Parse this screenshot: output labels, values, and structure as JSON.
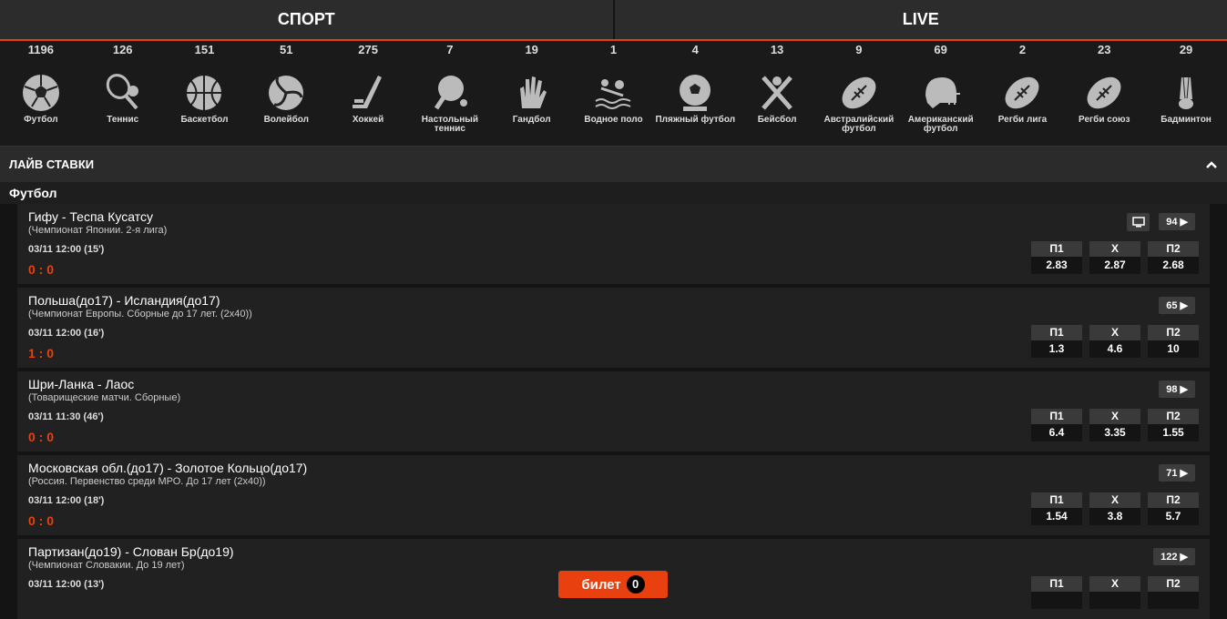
{
  "tabs": [
    "СПОРТ",
    "LIVE"
  ],
  "sports": [
    {
      "count": "1196",
      "label": "Футбол",
      "icon": "soccer-ball-icon"
    },
    {
      "count": "126",
      "label": "Теннис",
      "icon": "tennis-racket-icon"
    },
    {
      "count": "151",
      "label": "Баскетбол",
      "icon": "basketball-icon"
    },
    {
      "count": "51",
      "label": "Волейбол",
      "icon": "volleyball-icon"
    },
    {
      "count": "275",
      "label": "Хоккей",
      "icon": "hockey-stick-icon"
    },
    {
      "count": "7",
      "label": "Настольный теннис",
      "icon": "table-tennis-icon"
    },
    {
      "count": "19",
      "label": "Гандбол",
      "icon": "handball-glove-icon"
    },
    {
      "count": "1",
      "label": "Водное поло",
      "icon": "water-polo-icon"
    },
    {
      "count": "4",
      "label": "Пляжный футбол",
      "icon": "beach-soccer-icon"
    },
    {
      "count": "13",
      "label": "Бейсбол",
      "icon": "baseball-bats-icon"
    },
    {
      "count": "9",
      "label": "Австралийский футбол",
      "icon": "aussie-football-icon"
    },
    {
      "count": "69",
      "label": "Американский футбол",
      "icon": "football-helmet-icon"
    },
    {
      "count": "2",
      "label": "Регби лига",
      "icon": "rugby-ball-icon"
    },
    {
      "count": "23",
      "label": "Регби союз",
      "icon": "rugby-union-ball-icon"
    },
    {
      "count": "29",
      "label": "Бадминтон",
      "icon": "shuttlecock-icon"
    }
  ],
  "section": {
    "title": "ЛАЙВ СТАВКИ"
  },
  "category": "Футбол",
  "matches": [
    {
      "title": "Гифу - Теспа Кусатсу",
      "league": "(Чемпионат Японии. 2-я лига)",
      "time": "03/11 12:00 (15')",
      "score": "0 : 0",
      "more": "94 ▶",
      "tv": true,
      "odds": [
        {
          "h": "П1",
          "v": "2.83"
        },
        {
          "h": "Х",
          "v": "2.87"
        },
        {
          "h": "П2",
          "v": "2.68"
        }
      ]
    },
    {
      "title": "Польша(до17) - Исландия(до17)",
      "league": "(Чемпионат Европы. Сборные до 17 лет. (2х40))",
      "time": "03/11 12:00 (16')",
      "score": "1 : 0",
      "more": "65 ▶",
      "tv": false,
      "odds": [
        {
          "h": "П1",
          "v": "1.3"
        },
        {
          "h": "Х",
          "v": "4.6"
        },
        {
          "h": "П2",
          "v": "10"
        }
      ]
    },
    {
      "title": "Шри-Ланка - Лаос",
      "league": "(Товарищеские матчи. Сборные)",
      "time": "03/11 11:30 (46')",
      "score": "0 : 0",
      "more": "98 ▶",
      "tv": false,
      "odds": [
        {
          "h": "П1",
          "v": "6.4"
        },
        {
          "h": "Х",
          "v": "3.35"
        },
        {
          "h": "П2",
          "v": "1.55"
        }
      ]
    },
    {
      "title": "Московская обл.(до17) - Золотое Кольцо(до17)",
      "league": "(Россия. Первенство среди МРО. До 17 лет (2х40))",
      "time": "03/11 12:00 (18')",
      "score": "0 : 0",
      "more": "71 ▶",
      "tv": false,
      "odds": [
        {
          "h": "П1",
          "v": "1.54"
        },
        {
          "h": "Х",
          "v": "3.8"
        },
        {
          "h": "П2",
          "v": "5.7"
        }
      ]
    },
    {
      "title": "Партизан(до19) - Слован Бр(до19)",
      "league": "(Чемпионат Словакии. До 19 лет)",
      "time": "03/11 12:00 (13')",
      "score": "",
      "more": "122 ▶",
      "tv": false,
      "odds": [
        {
          "h": "П1",
          "v": ""
        },
        {
          "h": "Х",
          "v": ""
        },
        {
          "h": "П2",
          "v": ""
        }
      ]
    }
  ],
  "ticket": {
    "label": "билет",
    "count": "0"
  },
  "colors": {
    "accent": "#e8410f",
    "bg": "#141414",
    "panel": "#212121"
  }
}
